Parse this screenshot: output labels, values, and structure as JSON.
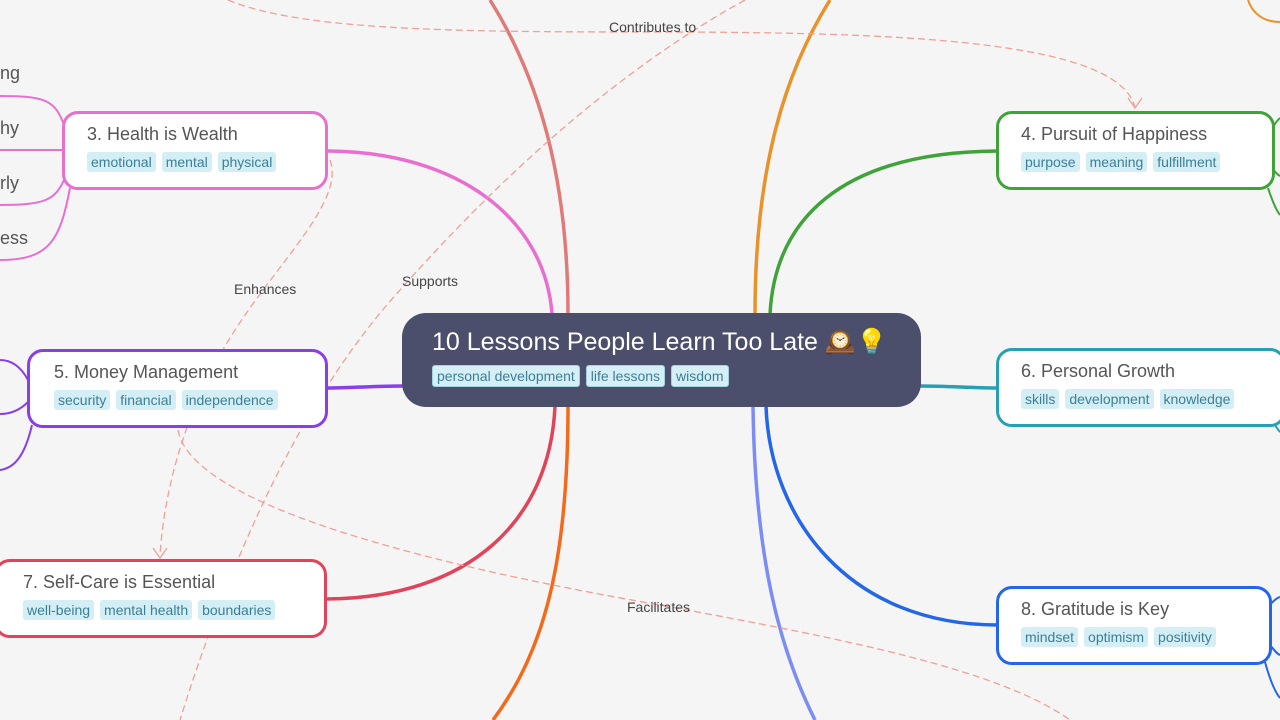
{
  "root": {
    "title": "10 Lessons People Learn Too Late",
    "emoji": "🕰️💡",
    "tags": [
      "personal development",
      "life lessons",
      "wisdom"
    ]
  },
  "nodes": [
    {
      "id": "health",
      "title": "3. Health is Wealth",
      "tags": [
        "emotional",
        "mental",
        "physical"
      ],
      "color": "#e86fd0"
    },
    {
      "id": "money",
      "title": "5. Money Management",
      "tags": [
        "security",
        "financial",
        "independence"
      ],
      "color": "#8a3fe6"
    },
    {
      "id": "selfcare",
      "title": "7. Self-Care is Essential",
      "tags": [
        "well-being",
        "mental health",
        "boundaries"
      ],
      "color": "#e0435a"
    },
    {
      "id": "happiness",
      "title": "4. Pursuit of Happiness",
      "tags": [
        "purpose",
        "meaning",
        "fulfillment"
      ],
      "color": "#3fa33a"
    },
    {
      "id": "growth",
      "title": "6. Personal Growth",
      "tags": [
        "skills",
        "development",
        "knowledge"
      ],
      "color": "#27a0b5"
    },
    {
      "id": "gratitude",
      "title": "8. Gratitude is Key",
      "tags": [
        "mindset",
        "optimism",
        "positivity"
      ],
      "color": "#2366e8"
    }
  ],
  "partial_leaves": [
    "ng",
    "hy",
    "rly",
    "ess"
  ],
  "relationships": [
    {
      "label": "Contributes to"
    },
    {
      "label": "Enhances"
    },
    {
      "label": "Supports"
    },
    {
      "label": "Facilitates"
    }
  ],
  "colors": {
    "relationship": "#f0a096",
    "branch_top_left": "#e07a78",
    "branch_top_right": "#e8922a",
    "branch_bottom_left": "#f36a1a",
    "branch_bottom_right": "#7b8cf5"
  }
}
